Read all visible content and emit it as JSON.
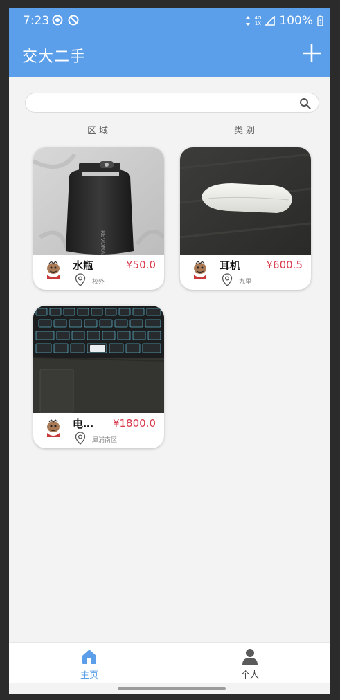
{
  "status": {
    "time": "7:23",
    "net_top": "4G",
    "net_bottom": "1X",
    "battery": "100%"
  },
  "header": {
    "title": "交大二手",
    "add_icon": "plus-icon"
  },
  "search": {
    "placeholder": "",
    "value": ""
  },
  "filters": {
    "region": "区域",
    "category": "类别"
  },
  "items": [
    {
      "title": "水瓶",
      "price": "¥50.0",
      "location": "校外"
    },
    {
      "title": "耳机",
      "price": "¥600.5",
      "location": "九里"
    },
    {
      "title": "电…",
      "price": "¥1800.0",
      "location": "犀浦南区"
    }
  ],
  "nav": {
    "home": "主页",
    "profile": "个人",
    "active": "home"
  },
  "colors": {
    "primary": "#5b9ee9",
    "price": "#d9394b",
    "background": "#f3f3f3"
  }
}
